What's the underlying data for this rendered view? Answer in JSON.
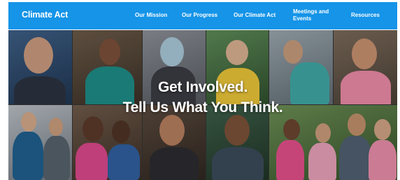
{
  "nav": {
    "logo": "Climate Act",
    "items": [
      {
        "label": "Our Mission"
      },
      {
        "label": "Our Progress"
      },
      {
        "label": "Our Climate Act"
      },
      {
        "label": "Meetings and Events"
      },
      {
        "label": "Resources"
      }
    ]
  },
  "hero": {
    "line1": "Get Involved.",
    "line2": "Tell Us What You Think."
  },
  "colors": {
    "nav_bg": "#1594e8",
    "text": "#ffffff"
  }
}
